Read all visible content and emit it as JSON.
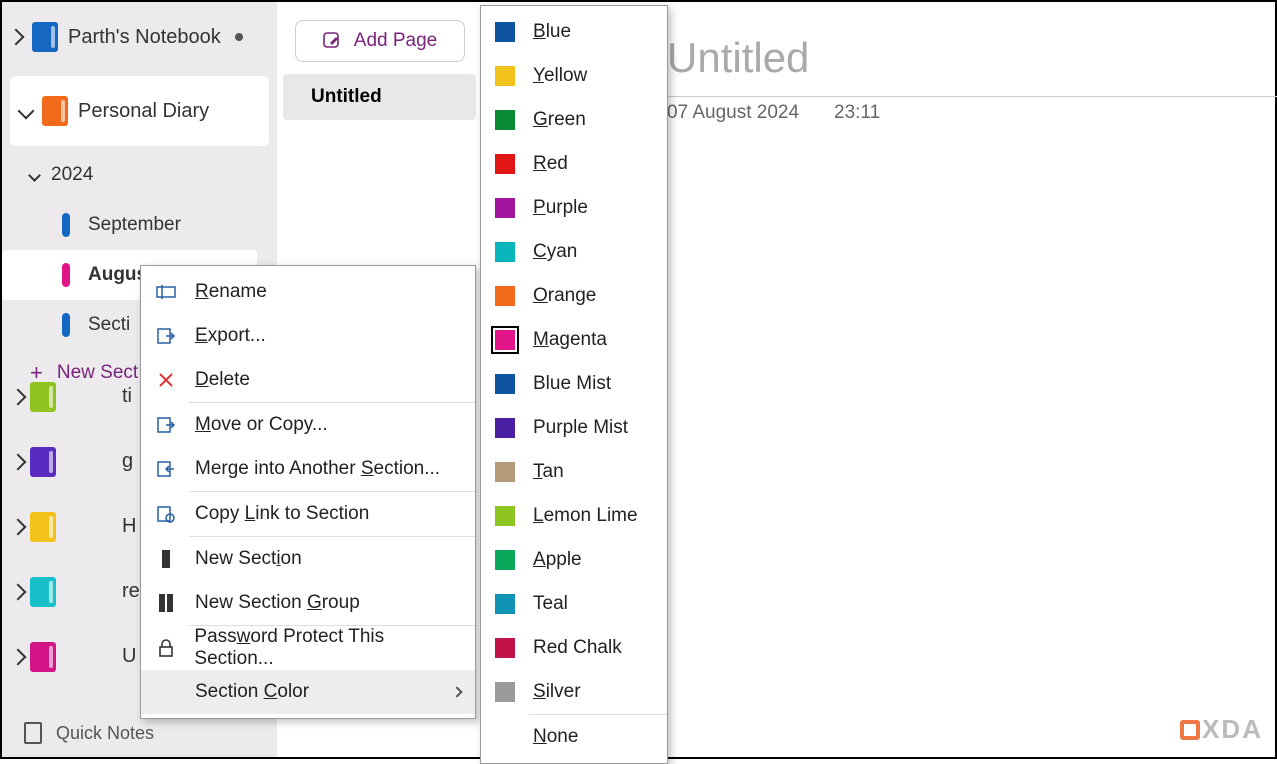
{
  "notebooks": {
    "primary": {
      "name": "Parth's Notebook",
      "color": "#1567c1"
    },
    "open": {
      "name": "Personal Diary",
      "color": "#f26a1b"
    },
    "others": [
      {
        "color": "#8fc320",
        "hint": "ti"
      },
      {
        "color": "#5a2bc0",
        "hint": "g"
      },
      {
        "color": "#f2c21a",
        "hint": "H"
      },
      {
        "color": "#18c0c9",
        "hint": "re"
      },
      {
        "color": "#d41587",
        "hint": "U"
      }
    ]
  },
  "tree": {
    "year": "2024",
    "sections": [
      {
        "label": "September",
        "color": "#1567c1",
        "active": false
      },
      {
        "label": "August",
        "color": "#e21588",
        "active": true
      },
      {
        "label": "Secti",
        "color": "#1567c1",
        "active": false
      }
    ],
    "new_section_label": "New Sect"
  },
  "quick_notes_label": "Quick Notes",
  "pagelist": {
    "add_label": "Add Page",
    "pages": [
      {
        "title": "Untitled"
      }
    ]
  },
  "note": {
    "title_placeholder": "Untitled",
    "date": "07 August 2024",
    "time": "23:11"
  },
  "ctx_menu": {
    "items": [
      {
        "id": "rename",
        "label_pre": "",
        "u": "R",
        "label_post": "ename"
      },
      {
        "id": "export",
        "label_pre": "",
        "u": "E",
        "label_post": "xport..."
      },
      {
        "id": "delete",
        "label_pre": "",
        "u": "D",
        "label_post": "elete"
      },
      {
        "id": "move",
        "label_pre": "",
        "u": "M",
        "label_post": "ove or Copy..."
      },
      {
        "id": "merge",
        "label_pre": "Merge into Another ",
        "u": "S",
        "label_post": "ection..."
      },
      {
        "id": "copylink",
        "label_pre": "Copy ",
        "u": "L",
        "label_post": "ink to Section"
      },
      {
        "id": "newsection",
        "label_pre": "New Sect",
        "u": "i",
        "label_post": "on"
      },
      {
        "id": "newgroup",
        "label_pre": "New Section ",
        "u": "G",
        "label_post": "roup"
      },
      {
        "id": "password",
        "label_pre": "Pass",
        "u": "w",
        "label_post": "ord Protect This Section..."
      },
      {
        "id": "sectioncolor",
        "label_pre": "Section ",
        "u": "C",
        "label_post": "olor"
      }
    ]
  },
  "color_menu": {
    "colors": [
      {
        "u": "B",
        "post": "lue",
        "hex": "#1053a1",
        "selected": false
      },
      {
        "u": "Y",
        "post": "ellow",
        "hex": "#f2c21a",
        "selected": false
      },
      {
        "u": "G",
        "post": "reen",
        "hex": "#0a8a33",
        "selected": false
      },
      {
        "u": "R",
        "post": "ed",
        "hex": "#e11515",
        "selected": false
      },
      {
        "u": "P",
        "post": "urple",
        "hex": "#a3149e",
        "selected": false
      },
      {
        "u": "C",
        "post": "yan",
        "hex": "#07b5bb",
        "selected": false
      },
      {
        "u": "O",
        "post": "range",
        "hex": "#f26a1b",
        "selected": false
      },
      {
        "u": "M",
        "post": "agenta",
        "hex": "#e21588",
        "selected": true
      },
      {
        "u": "",
        "post": "Blue Mist",
        "hex": "#1053a1",
        "selected": false
      },
      {
        "u": "",
        "post": "Purple Mist",
        "hex": "#4b1fa1",
        "selected": false
      },
      {
        "u": "T",
        "post": "an",
        "hex": "#b59a7a",
        "selected": false
      },
      {
        "u": "L",
        "post": "emon Lime",
        "hex": "#8fc320",
        "selected": false
      },
      {
        "u": "A",
        "post": "pple",
        "hex": "#0aa85a",
        "selected": false
      },
      {
        "u": "",
        "post": "Teal",
        "hex": "#1193b5",
        "selected": false
      },
      {
        "u": "",
        "post": "Red Chalk",
        "hex": "#c1124a",
        "selected": false
      },
      {
        "u": "S",
        "post": "ilver",
        "hex": "#9a9a9a",
        "selected": false
      }
    ],
    "none_u": "N",
    "none_post": "one"
  },
  "watermark": "XDA"
}
